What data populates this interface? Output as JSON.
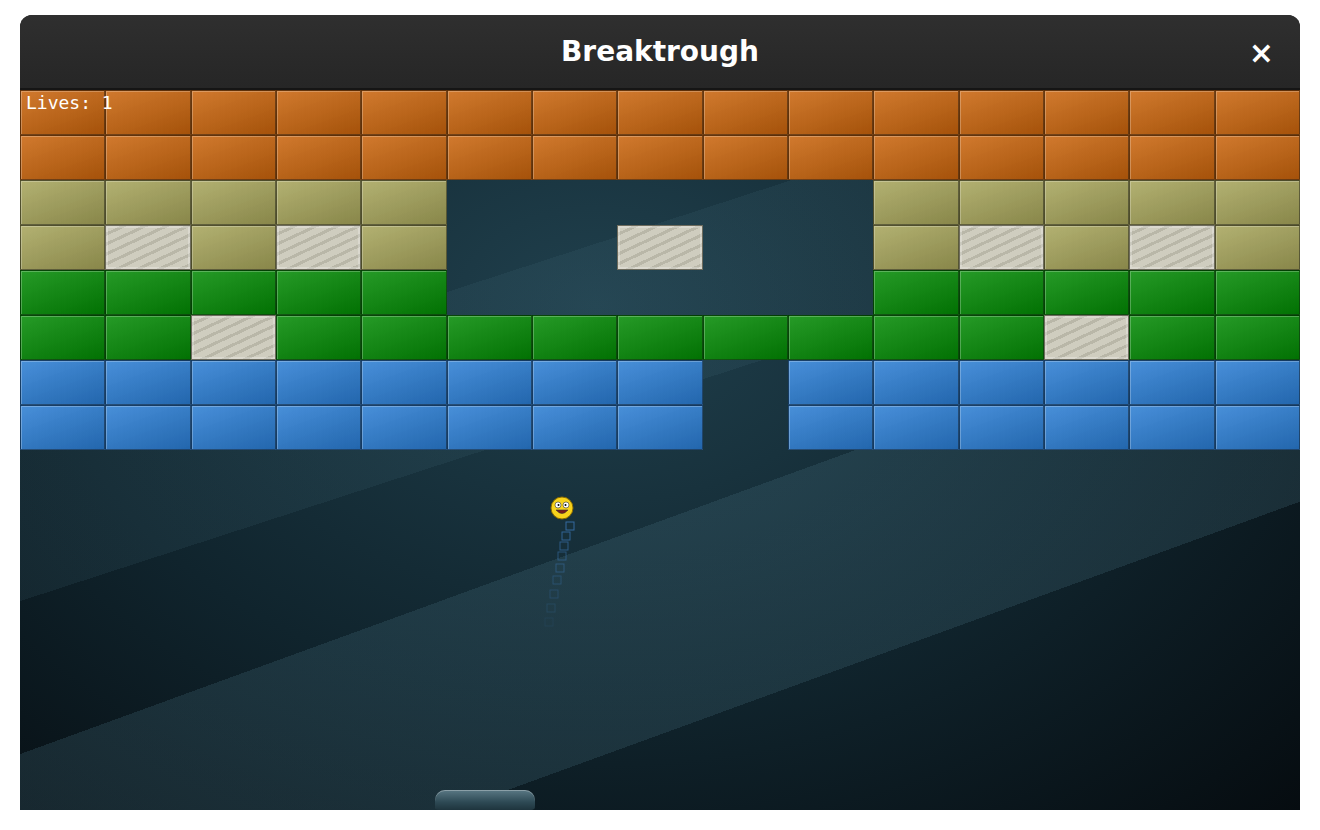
{
  "window": {
    "title": "Breaktrough",
    "close": "×"
  },
  "hud": {
    "lives": "Lives: 1"
  },
  "brick_rows": [
    {
      "color": "#c9640c",
      "bricks": [
        "solid",
        "solid",
        "solid",
        "solid",
        "solid",
        "solid",
        "solid",
        "solid",
        "solid",
        "solid",
        "solid",
        "solid",
        "solid",
        "solid",
        "solid"
      ]
    },
    {
      "color": "#c9640c",
      "bricks": [
        "solid",
        "solid",
        "solid",
        "solid",
        "solid",
        "solid",
        "solid",
        "solid",
        "solid",
        "solid",
        "solid",
        "solid",
        "solid",
        "solid",
        "solid"
      ]
    },
    {
      "color": "#a6a45a",
      "bricks": [
        "solid",
        "solid",
        "solid",
        "solid",
        "solid",
        "empty",
        "empty",
        "empty",
        "empty",
        "empty",
        "solid",
        "solid",
        "solid",
        "solid",
        "solid"
      ]
    },
    {
      "color": "#a6a45a",
      "bricks": [
        "solid",
        "stone",
        "solid",
        "stone",
        "solid",
        "empty",
        "empty",
        "stone",
        "empty",
        "empty",
        "solid",
        "stone",
        "solid",
        "stone",
        "solid"
      ]
    },
    {
      "color": "#028a04",
      "bricks": [
        "solid",
        "solid",
        "solid",
        "solid",
        "solid",
        "empty",
        "empty",
        "empty",
        "empty",
        "empty",
        "solid",
        "solid",
        "solid",
        "solid",
        "solid"
      ]
    },
    {
      "color": "#028a04",
      "bricks": [
        "solid",
        "solid",
        "stone",
        "solid",
        "solid",
        "solid",
        "solid",
        "solid",
        "solid",
        "solid",
        "solid",
        "solid",
        "stone",
        "solid",
        "solid"
      ]
    },
    {
      "color": "#2a7dd3",
      "bricks": [
        "solid",
        "solid",
        "solid",
        "solid",
        "solid",
        "solid",
        "solid",
        "solid",
        "empty",
        "solid",
        "solid",
        "solid",
        "solid",
        "solid",
        "solid"
      ]
    },
    {
      "color": "#2a7dd3",
      "bricks": [
        "solid",
        "solid",
        "solid",
        "solid",
        "solid",
        "solid",
        "solid",
        "solid",
        "empty",
        "solid",
        "solid",
        "solid",
        "solid",
        "solid",
        "solid"
      ]
    }
  ]
}
